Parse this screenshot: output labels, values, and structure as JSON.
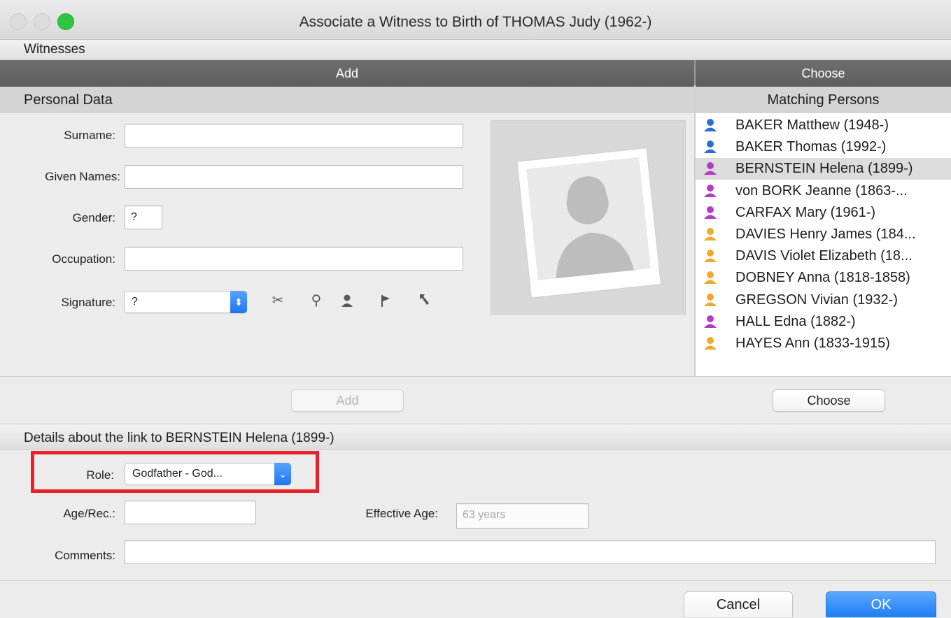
{
  "window": {
    "title": "Associate a Witness to Birth of THOMAS Judy (1962-)"
  },
  "witnesses_label": "Witnesses",
  "panel_headers": {
    "add": "Add",
    "choose": "Choose"
  },
  "personal_data": {
    "section_title": "Personal Data",
    "surname_label": "Surname:",
    "surname_value": "",
    "given_names_label": "Given Names:",
    "given_names_value": "",
    "gender_label": "Gender:",
    "gender_value": "?",
    "occupation_label": "Occupation:",
    "occupation_value": "",
    "signature_label": "Signature:",
    "signature_value": "?",
    "signature_tools": [
      "signature-scissors-icon",
      "signature-magnify-icon",
      "signature-person-icon",
      "signature-flag-icon",
      "signature-pointer-icon"
    ],
    "add_button": "Add"
  },
  "matching": {
    "title": "Matching Persons",
    "choose_button": "Choose",
    "persons": [
      {
        "name": "BAKER Matthew (1948-)",
        "gender": "male",
        "color": "#2a6bd6",
        "selected": false
      },
      {
        "name": "BAKER Thomas (1992-)",
        "gender": "male",
        "color": "#2a6bd6",
        "selected": false
      },
      {
        "name": "BERNSTEIN Helena (1899-)",
        "gender": "female",
        "color": "#b23cc8",
        "selected": true
      },
      {
        "name": "von BORK Jeanne (1863-...",
        "gender": "female",
        "color": "#b23cc8",
        "selected": false
      },
      {
        "name": "CARFAX Mary (1961-)",
        "gender": "female",
        "color": "#b23cc8",
        "selected": false
      },
      {
        "name": "DAVIES Henry James (184...",
        "gender": "unknown",
        "color": "#f1a92b",
        "selected": false
      },
      {
        "name": "DAVIS Violet Elizabeth (18...",
        "gender": "unknown",
        "color": "#f1a92b",
        "selected": false
      },
      {
        "name": "DOBNEY Anna (1818-1858)",
        "gender": "unknown",
        "color": "#f1a92b",
        "selected": false
      },
      {
        "name": "GREGSON Vivian (1932-)",
        "gender": "unknown",
        "color": "#f1a92b",
        "selected": false
      },
      {
        "name": "HALL Edna (1882-)",
        "gender": "female",
        "color": "#b23cc8",
        "selected": false
      },
      {
        "name": "HAYES Ann (1833-1915)",
        "gender": "unknown",
        "color": "#f1a92b",
        "selected": false
      }
    ]
  },
  "details": {
    "title": "Details about the link to BERNSTEIN Helena (1899-)",
    "role_label": "Role:",
    "role_value": "Godfather - God...",
    "age_label": "Age/Rec.:",
    "age_value": "",
    "effective_age_label": "Effective Age:",
    "effective_age_placeholder": "63 years",
    "comments_label": "Comments:",
    "comments_value": ""
  },
  "footer": {
    "cancel": "Cancel",
    "ok": "OK"
  },
  "colors": {
    "accent": "#1f7df5",
    "highlight": "#e8202a"
  }
}
